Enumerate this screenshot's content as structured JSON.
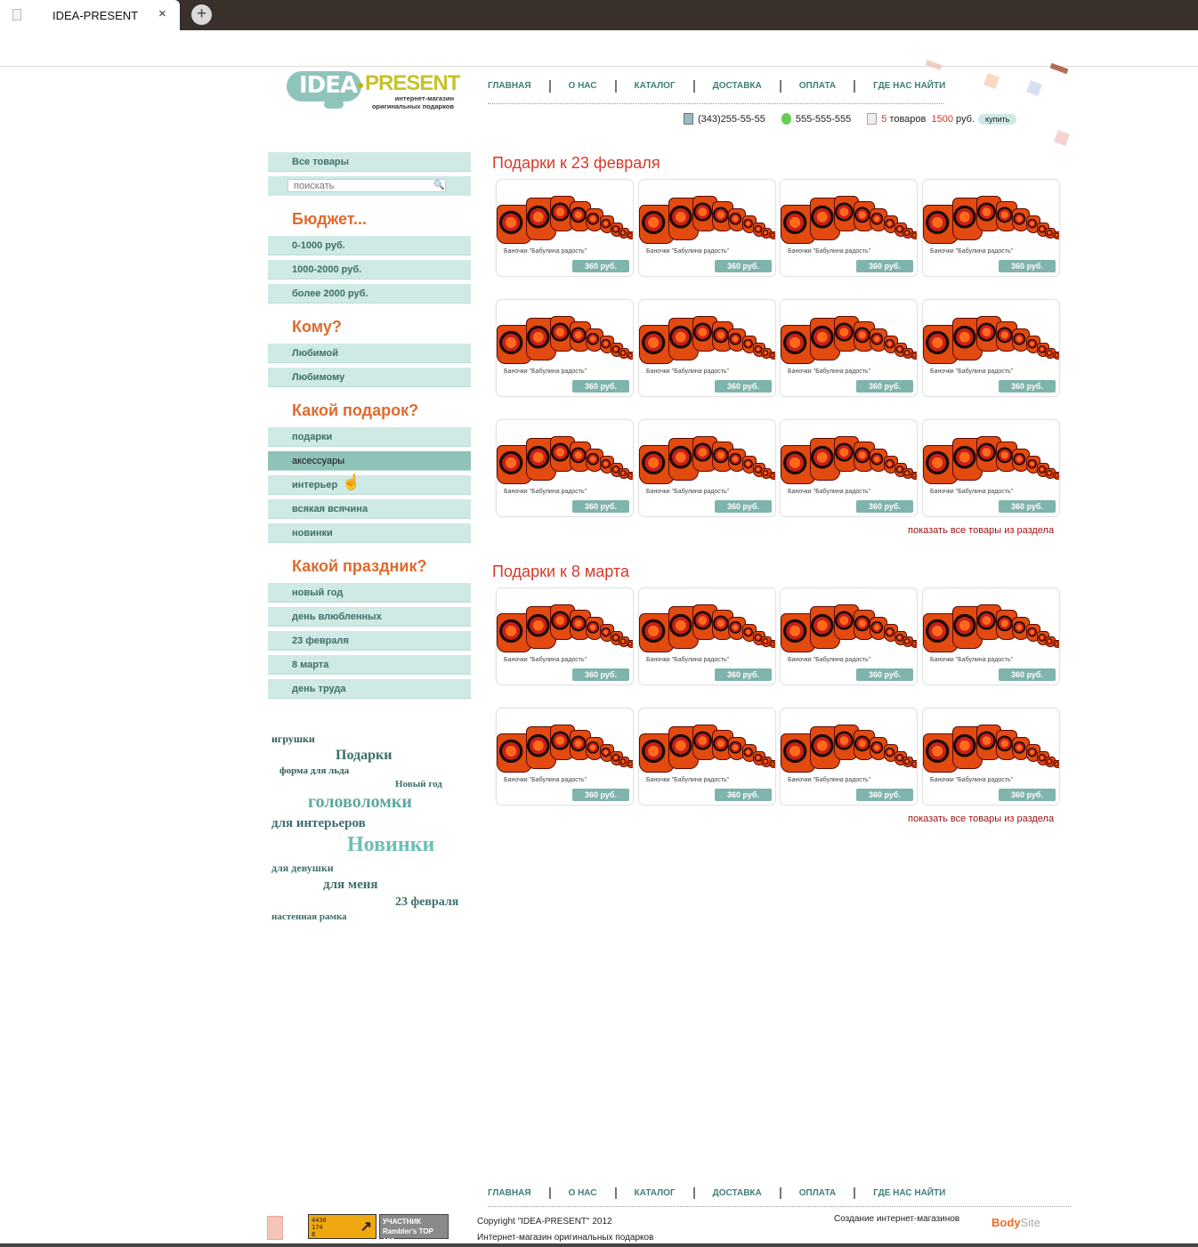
{
  "browser": {
    "tab_title": "IDEA-PRESENT",
    "new_tab": "+",
    "close": "×"
  },
  "logo": {
    "idea": "IDEA",
    "present": "PRESENT",
    "tagline": "интернет-магазин оригинальных подарков"
  },
  "nav": [
    "ГЛАВНАЯ",
    "О НАС",
    "КАТАЛОГ",
    "ДОСТАВКА",
    "ОПЛАТА",
    "ГДЕ НАС НАЙТИ"
  ],
  "contacts": {
    "phone1": "(343)255-55-55",
    "phone2": "555-555-555",
    "cart_count": "5",
    "cart_items_label": "товаров",
    "cart_sum": "1500",
    "cart_currency": "руб.",
    "buy": "купить"
  },
  "sidebar": {
    "all_goods": "Все товары",
    "search_placeholder": "поискать",
    "budget": {
      "title": "Бюджет...",
      "items": [
        "0-1000 руб.",
        "1000-2000 руб.",
        "более 2000 руб."
      ]
    },
    "whom": {
      "title": "Кому?",
      "items": [
        "Любимой",
        "Любимому"
      ]
    },
    "kind": {
      "title": "Какой подарок?",
      "items": [
        "подарки",
        "аксессуары",
        "интерьер",
        "всякая всячина",
        "новинки"
      ]
    },
    "holiday": {
      "title": "Какой праздник?",
      "items": [
        "новый год",
        "день влюбленных",
        "23 февраля",
        "8 марта",
        "день труда"
      ]
    }
  },
  "tags": [
    "игрушки",
    "Подарки",
    "форма для льда",
    "Новый год",
    "головоломки",
    "для интерьеров",
    "Новинки",
    "для девушки",
    "для меня",
    "23 февраля",
    "настенная рамка"
  ],
  "sections": [
    {
      "title": "Подарки к 23 февраля",
      "show_all": "показать все товары из раздела"
    },
    {
      "title": "Подарки к 8 марта",
      "show_all": "показать все товары из раздела"
    }
  ],
  "product": {
    "name": "Баночки \"Бабулина радость\"",
    "price": "360 руб."
  },
  "footer": {
    "copyright": "Copyright \"IDEA-PRESENT\" 2012",
    "subtitle": "Интернет-магазин оригинальных подарков",
    "maker": "Создание интернет-магазинов",
    "bodysite_a": "Body",
    "bodysite_b": "Site",
    "counter": "4436\n174\n8",
    "rambler": "УЧАСТНИК Rambler's TOP 100"
  }
}
